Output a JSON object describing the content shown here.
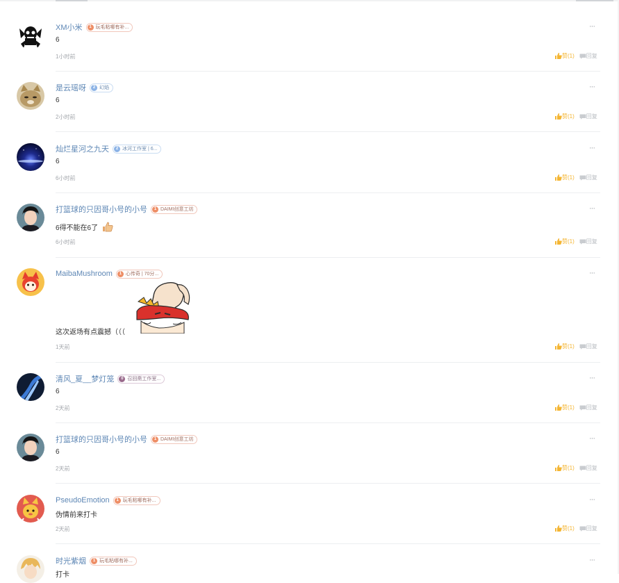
{
  "comments": [
    {
      "username": "XM小米",
      "level": "1",
      "badge": "玩毛粘哪有补...",
      "text": "6",
      "time": "1小时前"
    },
    {
      "username": "是云瑶呀",
      "level": "2",
      "badge": "幻焰",
      "text": "6",
      "time": "2小时前"
    },
    {
      "username": "灿烂星河之九天",
      "level": "2",
      "badge": "冰河工作室 | 6...",
      "text": "6",
      "time": "6小时前"
    },
    {
      "username": "打篮球的只因哥小号的小号",
      "level": "1",
      "badge": "DAIMI创意工坊",
      "text": "6得不能在6了",
      "time": "6小时前"
    },
    {
      "username": "MaibaMushroom",
      "level": "1",
      "badge": "心传奇 | 70分...",
      "text": "这次返场有点震撼（（（",
      "time": "1天前"
    },
    {
      "username": "清风_夏__梦灯笼",
      "level": "0",
      "badge": "召回斋工作室...",
      "text": "6",
      "time": "2天前"
    },
    {
      "username": "打篮球的只因哥小号的小号",
      "level": "1",
      "badge": "DAIMI创意工坊",
      "text": "6",
      "time": "2天前"
    },
    {
      "username": "PseudoEmotion",
      "level": "1",
      "badge": "玩毛粘哪有补...",
      "text": "伪情前来打卡",
      "time": "2天前"
    },
    {
      "username": "时光紫烟",
      "level": "1",
      "badge": "玩毛粘哪有补...",
      "text": "打卡",
      "time": ""
    }
  ],
  "actions": {
    "like_label": "赞(1)",
    "reply_label": "回复",
    "more": "···"
  },
  "colors": {
    "username": "#5e87b5",
    "like": "#f4b532",
    "muted": "#a2a6ab"
  }
}
